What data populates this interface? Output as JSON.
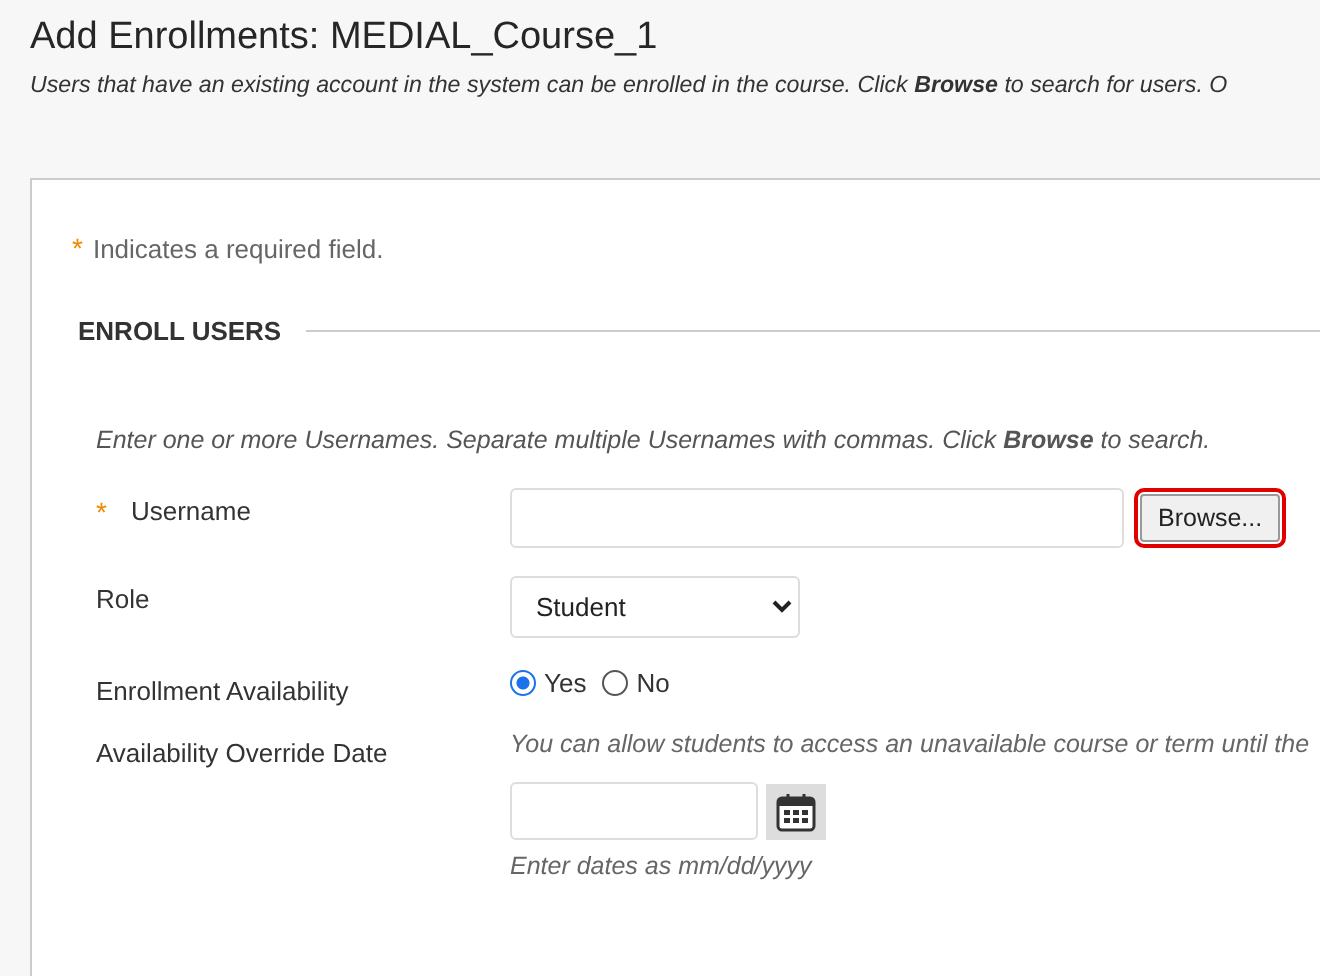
{
  "page": {
    "title": "Add Enrollments: MEDIAL_Course_1",
    "instructions": "Users that have an existing account in the system can be enrolled in the course. Click **Browse** to search for users. O"
  },
  "required_note": {
    "mark": "*",
    "text": "Indicates a required field."
  },
  "section": {
    "title": "ENROLL USERS",
    "instructions": "Enter one or more Usernames. Separate multiple Usernames with commas. Click **Browse** to search."
  },
  "fields": [
    {
      "kind": "text",
      "label": "Username",
      "required": true,
      "required_mark": "*",
      "button": {
        "label": "Browse...",
        "highlighted": true
      }
    },
    {
      "kind": "select",
      "label": "Role",
      "required": false,
      "value": "Student"
    },
    {
      "kind": "radio",
      "label": "Enrollment Availability",
      "required": false,
      "options": [
        {
          "label": "Yes",
          "selected": true
        },
        {
          "label": "No",
          "selected": false
        }
      ]
    },
    {
      "kind": "date",
      "label": "Availability Override Date",
      "required": false,
      "help": "You can allow students to access an unavailable course or term until the",
      "hint": "Enter dates as mm/dd/yyyy"
    }
  ]
}
